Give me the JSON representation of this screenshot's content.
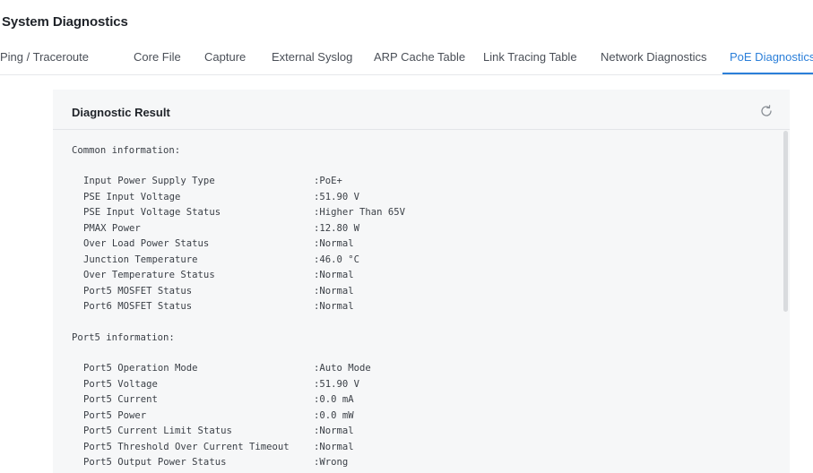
{
  "page_title": "System Diagnostics",
  "tabs": [
    {
      "label": "Ping / Traceroute",
      "active": false
    },
    {
      "label": "Core File",
      "active": false
    },
    {
      "label": "Capture",
      "active": false
    },
    {
      "label": "External Syslog",
      "active": false
    },
    {
      "label": "ARP Cache Table",
      "active": false
    },
    {
      "label": "Link Tracing Table",
      "active": false
    },
    {
      "label": "Network Diagnostics",
      "active": false
    },
    {
      "label": "PoE Diagnostics",
      "active": true
    }
  ],
  "result": {
    "title": "Diagnostic Result",
    "refresh_icon": "refresh-icon",
    "common_label": "Common information:",
    "common": [
      {
        "key": "Input Power Supply Type",
        "value": ":PoE+"
      },
      {
        "key": "PSE Input Voltage",
        "value": ":51.90 V"
      },
      {
        "key": "PSE Input Voltage Status",
        "value": ":Higher Than 65V"
      },
      {
        "key": "PMAX Power",
        "value": ":12.80 W"
      },
      {
        "key": "Over Load Power Status",
        "value": ":Normal"
      },
      {
        "key": "Junction Temperature",
        "value": ":46.0 °C"
      },
      {
        "key": "Over Temperature Status",
        "value": ":Normal"
      },
      {
        "key": "Port5 MOSFET Status",
        "value": ":Normal"
      },
      {
        "key": "Port6 MOSFET Status",
        "value": ":Normal"
      }
    ],
    "port5_label": "Port5 information:",
    "port5": [
      {
        "key": "Port5 Operation Mode",
        "value": ":Auto Mode"
      },
      {
        "key": "Port5 Voltage",
        "value": ":51.90 V"
      },
      {
        "key": "Port5 Current",
        "value": ":0.0 mA"
      },
      {
        "key": "Port5 Power",
        "value": ":0.0 mW"
      },
      {
        "key": "Port5 Current Limit Status",
        "value": ":Normal"
      },
      {
        "key": "Port5 Threshold Over Current Timeout",
        "value": ":Normal"
      },
      {
        "key": "Port5 Output Power Status",
        "value": ":Wrong"
      }
    ]
  },
  "colors": {
    "accent": "#2b7fd9",
    "panel_bg": "#f6f7f8",
    "text": "#3a3f46"
  }
}
